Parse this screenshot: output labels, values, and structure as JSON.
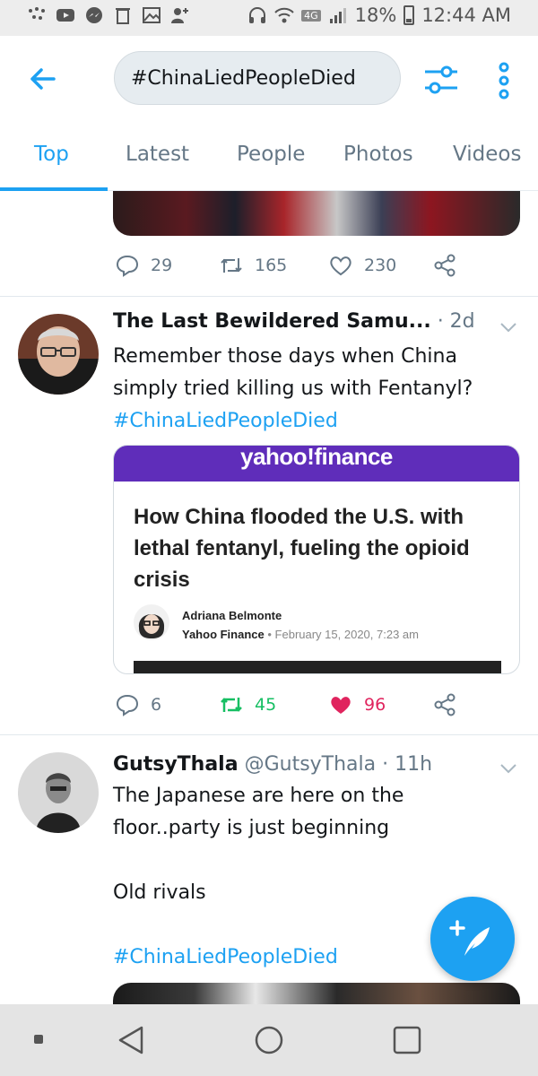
{
  "status_bar": {
    "network": "4G",
    "battery": "18%",
    "time": "12:44 AM"
  },
  "search": {
    "query": "#ChinaLiedPeopleDied"
  },
  "tabs": [
    {
      "label": "Top",
      "active": true
    },
    {
      "label": "Latest"
    },
    {
      "label": "People"
    },
    {
      "label": "Photos"
    },
    {
      "label": "Videos"
    }
  ],
  "tweets": [
    {
      "replies": "29",
      "retweets": "165",
      "likes": "230"
    },
    {
      "name": "The Last Bewildered Samu...",
      "meta": "· 2d",
      "text": "Remember those days when China simply tried killing us with Fentanyl?",
      "hashtag": "#ChinaLiedPeopleDied",
      "card": {
        "source_banner": "yahoo!finance",
        "title": "How China flooded the U.S. with lethal fentanyl, fueling the opioid crisis",
        "author": "Adriana Belmonte",
        "publisher": "Yahoo Finance",
        "date": "• February 15, 2020, 7:23 am"
      },
      "replies": "6",
      "retweets": "45",
      "likes": "96",
      "liked": true,
      "retweeted": true
    },
    {
      "name": "GutsyThala",
      "meta": "@GutsyThala · 11h",
      "text_line1": "The Japanese are here on the floor..party is just beginning",
      "text_line2": "Old rivals",
      "hashtag": "#ChinaLiedPeopleDied"
    }
  ],
  "colors": {
    "accent": "#1da1f2",
    "like_red": "#e0245e",
    "retweet_green": "#17bf63",
    "muted": "#657786"
  }
}
